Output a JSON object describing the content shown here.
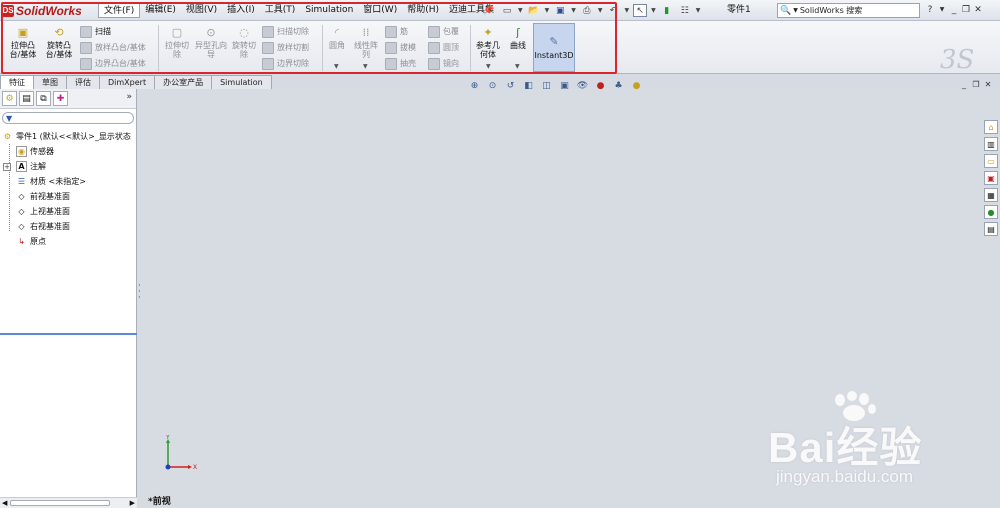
{
  "app": {
    "logo_text": "SolidWorks",
    "doc_title": "零件1"
  },
  "menu": [
    "文件(F)",
    "编辑(E)",
    "视图(V)",
    "插入(I)",
    "工具(T)",
    "Simulation",
    "窗口(W)",
    "帮助(H)",
    "迈迪工具集"
  ],
  "search": {
    "placeholder": "SolidWorks 搜索"
  },
  "window_controls": {
    "help": "?",
    "minimize": "_",
    "restore": "❐",
    "close": "✕"
  },
  "ribbon": {
    "extrude_boss": "拉伸凸台/基体",
    "revolve_boss": "旋转凸台/基体",
    "sweep": "扫描",
    "loft_boss": "放样凸台/基体",
    "boundary_boss": "边界凸台/基体",
    "extrude_cut": "拉伸切除",
    "hole_wizard": "异型孔向导",
    "revolve_cut": "旋转切除",
    "swept_cut": "扫描切除",
    "lofted_cut": "放样切割",
    "boundary_cut": "边界切除",
    "fillet": "圆角",
    "linear_pattern": "线性阵列",
    "rib": "筋",
    "draft": "拔模",
    "shell": "抽壳",
    "wrap": "包覆",
    "dome": "圆顶",
    "mirror": "镜向",
    "ref_geometry": "参考几何体",
    "curves": "曲线",
    "instant3d": "Instant3D"
  },
  "tabs": [
    "特征",
    "草图",
    "评估",
    "DimXpert",
    "办公室产品",
    "Simulation"
  ],
  "tree": {
    "root": "零件1 (默认<<默认>_显示状态",
    "items": [
      "传感器",
      "注解",
      "材质 <未指定>",
      "前视基准面",
      "上视基准面",
      "右视基准面",
      "原点"
    ]
  },
  "viewport": {
    "view_label": "*前视",
    "axis_x": "X",
    "axis_y": "Y"
  },
  "watermark": {
    "main": "Bai经验",
    "sub": "jingyan.baidu.com"
  },
  "colors": {
    "highlight_box": "#d9262c",
    "instant3d_active": "#c7d6ee"
  }
}
